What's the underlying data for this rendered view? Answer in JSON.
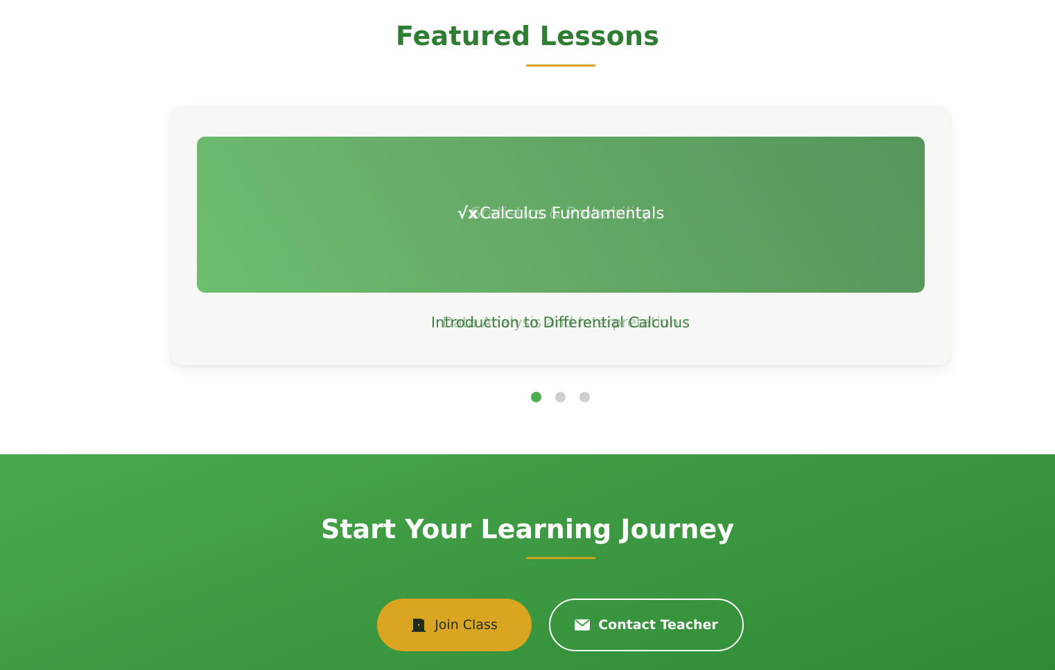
{
  "featured": {
    "title": "Featured Lessons",
    "slide": {
      "icon": "square-root-icon",
      "icon_glyph": "√x",
      "banner_title": "Calculus Fundamentals",
      "banner_ghost_title": "Statistics & Probability",
      "caption": "Introduction to Differential Calculus",
      "caption_ghost": "Data Analysis and Interpretation"
    },
    "dots": [
      {
        "label": "Slide 1",
        "active": true
      },
      {
        "label": "Slide 2",
        "active": false
      },
      {
        "label": "Slide 3",
        "active": false
      }
    ]
  },
  "cta": {
    "title": "Start Your Learning Journey",
    "join_label": "Join Class",
    "join_icon": "door-open-icon",
    "contact_label": "Contact Teacher",
    "contact_icon": "envelope-icon"
  },
  "colors": {
    "brand_green": "#2e7d32",
    "accent_gold": "#d4a421",
    "button_gold": "#daa520",
    "dot_active": "#4caf50",
    "dot_inactive": "#cfcfcf"
  }
}
